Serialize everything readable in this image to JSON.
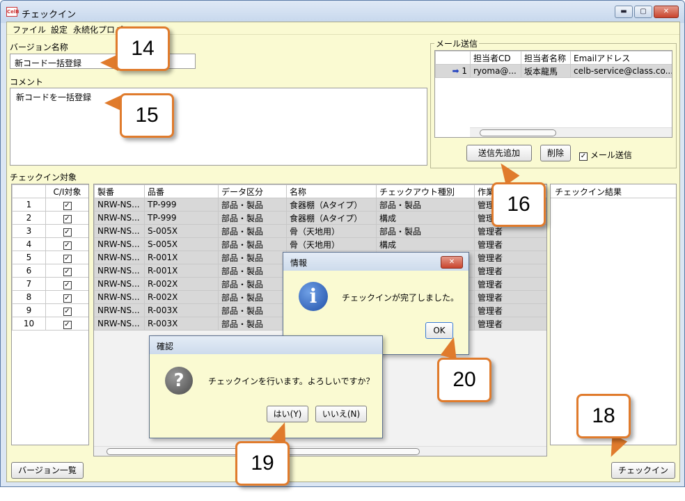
{
  "window": {
    "title": "チェックイン",
    "app_icon": "CelB",
    "min": "▬",
    "max": "▢",
    "close": "✕"
  },
  "menu": [
    "ファイル",
    "設定",
    "永続化プロパ"
  ],
  "form": {
    "version_label": "バージョン名称",
    "version_value": "新コード一括登録",
    "comment_label": "コメント",
    "comment_value": "新コードを一括登録"
  },
  "mail": {
    "group_title": "メール送信",
    "headers": [
      "担当者CD",
      "担当者名称",
      "Emailアドレス"
    ],
    "row": {
      "marker": "➡",
      "num": "1",
      "cd": "ryoma@...",
      "name": "坂本龍馬",
      "email": "celb-service@class.co...."
    },
    "add_button": "送信先追加",
    "delete_button": "削除",
    "checkbox_label": "メール送信",
    "checkbox_mark": "✓"
  },
  "targets": {
    "label": "チェックイン対象",
    "col": "C/I対象",
    "rows": [
      "1",
      "2",
      "3",
      "4",
      "5",
      "6",
      "7",
      "8",
      "9",
      "10"
    ],
    "check": "✓"
  },
  "grid": {
    "headers": [
      "製番",
      "品番",
      "データ区分",
      "名称",
      "チェックアウト種別",
      "作業者"
    ],
    "rows": [
      [
        "NRW-NS...",
        "TP-999",
        "部品・製品",
        "食器棚（Aタイプ）",
        "部品・製品",
        "管理者"
      ],
      [
        "NRW-NS...",
        "TP-999",
        "部品・製品",
        "食器棚（Aタイプ）",
        "構成",
        "管理者"
      ],
      [
        "NRW-NS...",
        "S-005X",
        "部品・製品",
        "骨（天地用）",
        "部品・製品",
        "管理者"
      ],
      [
        "NRW-NS...",
        "S-005X",
        "部品・製品",
        "骨（天地用）",
        "構成",
        "管理者"
      ],
      [
        "NRW-NS...",
        "R-001X",
        "部品・製品",
        "",
        "",
        "管理者"
      ],
      [
        "NRW-NS...",
        "R-001X",
        "部品・製品",
        "",
        "",
        "管理者"
      ],
      [
        "NRW-NS...",
        "R-002X",
        "部品・製品",
        "",
        "",
        "管理者"
      ],
      [
        "NRW-NS...",
        "R-002X",
        "部品・製品",
        "",
        "",
        "管理者"
      ],
      [
        "NRW-NS...",
        "R-003X",
        "部品・製品",
        "",
        "",
        "管理者"
      ],
      [
        "NRW-NS...",
        "R-003X",
        "部品・製品",
        "",
        "",
        "管理者"
      ]
    ]
  },
  "result": {
    "header": "チェックイン結果"
  },
  "buttons": {
    "version_list": "バージョン一覧",
    "checkin": "チェックイン"
  },
  "info_dialog": {
    "title": "情報",
    "message": "チェックインが完了しました。",
    "ok": "OK",
    "icon": "i",
    "close": "✕"
  },
  "confirm_dialog": {
    "title": "確認",
    "message": "チェックインを行います。よろしいですか？",
    "yes": "はい(Y)",
    "no": "いいえ(N)",
    "icon": "?"
  },
  "callouts": [
    "14",
    "15",
    "16",
    "18",
    "19",
    "20"
  ],
  "colors": {
    "panel": "#fafad2",
    "callout_border": "#e07b2c",
    "selected_row": "#d8d8d8"
  }
}
